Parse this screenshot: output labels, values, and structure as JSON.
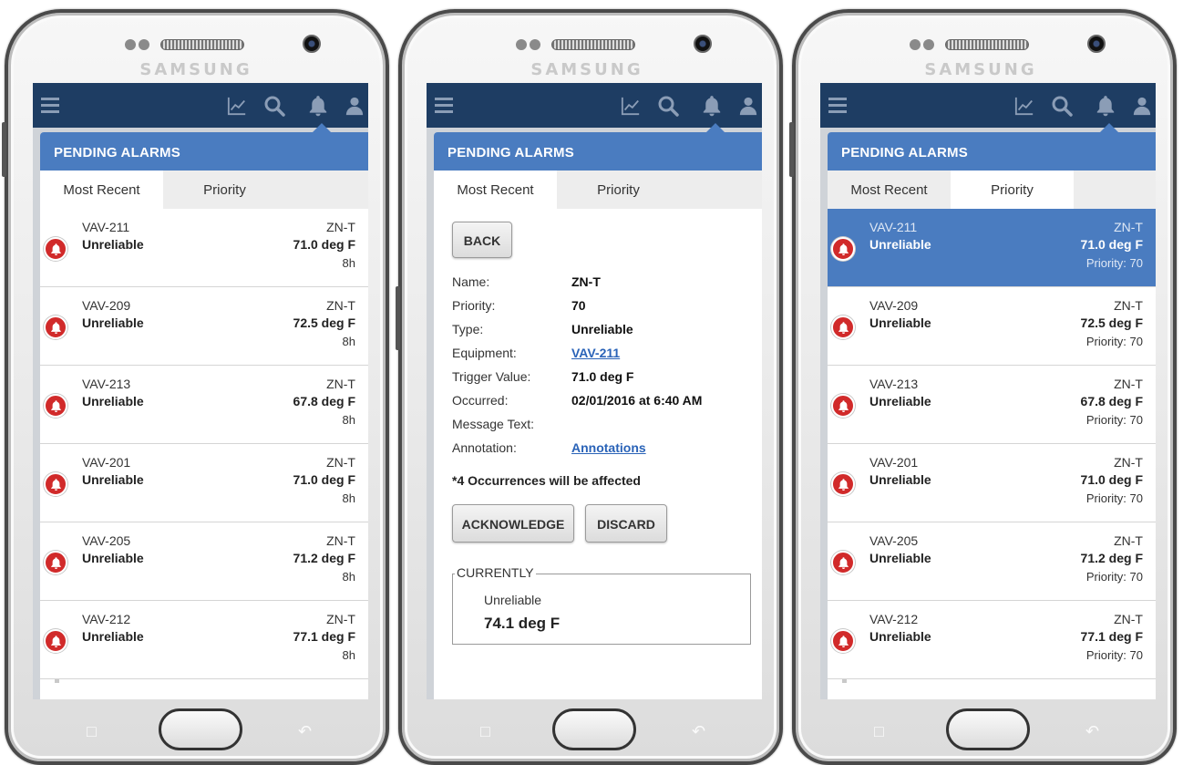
{
  "brand": "SAMSUNG",
  "header": {
    "title": "PENDING ALARMS"
  },
  "tabs": [
    {
      "label": "Most Recent"
    },
    {
      "label": "Priority"
    }
  ],
  "colors": {
    "appbar": "#1e3d63",
    "header": "#4a7cc0",
    "alarm_badge": "#d12a2a",
    "link": "#2a63b8"
  },
  "icons": [
    "menu-icon",
    "trend-chart-icon",
    "search-icon",
    "bell-icon",
    "person-icon"
  ],
  "screen_most_recent": {
    "active_tab": "Most Recent",
    "alarms": [
      {
        "equipment": "VAV-211",
        "type": "Unreliable",
        "point": "ZN-T",
        "value": "71.0 deg F",
        "age": "8h"
      },
      {
        "equipment": "VAV-209",
        "type": "Unreliable",
        "point": "ZN-T",
        "value": "72.5 deg F",
        "age": "8h"
      },
      {
        "equipment": "VAV-213",
        "type": "Unreliable",
        "point": "ZN-T",
        "value": "67.8 deg F",
        "age": "8h"
      },
      {
        "equipment": "VAV-201",
        "type": "Unreliable",
        "point": "ZN-T",
        "value": "71.0 deg F",
        "age": "8h"
      },
      {
        "equipment": "VAV-205",
        "type": "Unreliable",
        "point": "ZN-T",
        "value": "71.2 deg F",
        "age": "8h"
      },
      {
        "equipment": "VAV-212",
        "type": "Unreliable",
        "point": "ZN-T",
        "value": "77.1 deg F",
        "age": "8h"
      }
    ]
  },
  "screen_detail": {
    "active_tab": "Most Recent",
    "back_label": "BACK",
    "fields": [
      {
        "label": "Name:",
        "value": "ZN-T"
      },
      {
        "label": "Priority:",
        "value": "70"
      },
      {
        "label": "Type:",
        "value": "Unreliable"
      },
      {
        "label": "Equipment:",
        "value": "VAV-211"
      },
      {
        "label": "Trigger Value:",
        "value": "71.0 deg F"
      },
      {
        "label": "Occurred:",
        "value": "02/01/2016 at 6:40 AM"
      },
      {
        "label": "Message Text:",
        "value": ""
      },
      {
        "label": "Annotation:",
        "value": "Annotations"
      }
    ],
    "note": "*4 Occurrences will be affected",
    "acknowledge_label": "ACKNOWLEDGE",
    "discard_label": "DISCARD",
    "currently": {
      "legend": "CURRENTLY",
      "type": "Unreliable",
      "value": "74.1 deg F"
    }
  },
  "screen_priority": {
    "active_tab": "Priority",
    "selected_index": 0,
    "alarms": [
      {
        "equipment": "VAV-211",
        "type": "Unreliable",
        "point": "ZN-T",
        "value": "71.0 deg F",
        "priority": "Priority: 70"
      },
      {
        "equipment": "VAV-209",
        "type": "Unreliable",
        "point": "ZN-T",
        "value": "72.5 deg F",
        "priority": "Priority: 70"
      },
      {
        "equipment": "VAV-213",
        "type": "Unreliable",
        "point": "ZN-T",
        "value": "67.8 deg F",
        "priority": "Priority: 70"
      },
      {
        "equipment": "VAV-201",
        "type": "Unreliable",
        "point": "ZN-T",
        "value": "71.0 deg F",
        "priority": "Priority: 70"
      },
      {
        "equipment": "VAV-205",
        "type": "Unreliable",
        "point": "ZN-T",
        "value": "71.2 deg F",
        "priority": "Priority: 70"
      },
      {
        "equipment": "VAV-212",
        "type": "Unreliable",
        "point": "ZN-T",
        "value": "77.1 deg F",
        "priority": "Priority: 70"
      }
    ]
  }
}
